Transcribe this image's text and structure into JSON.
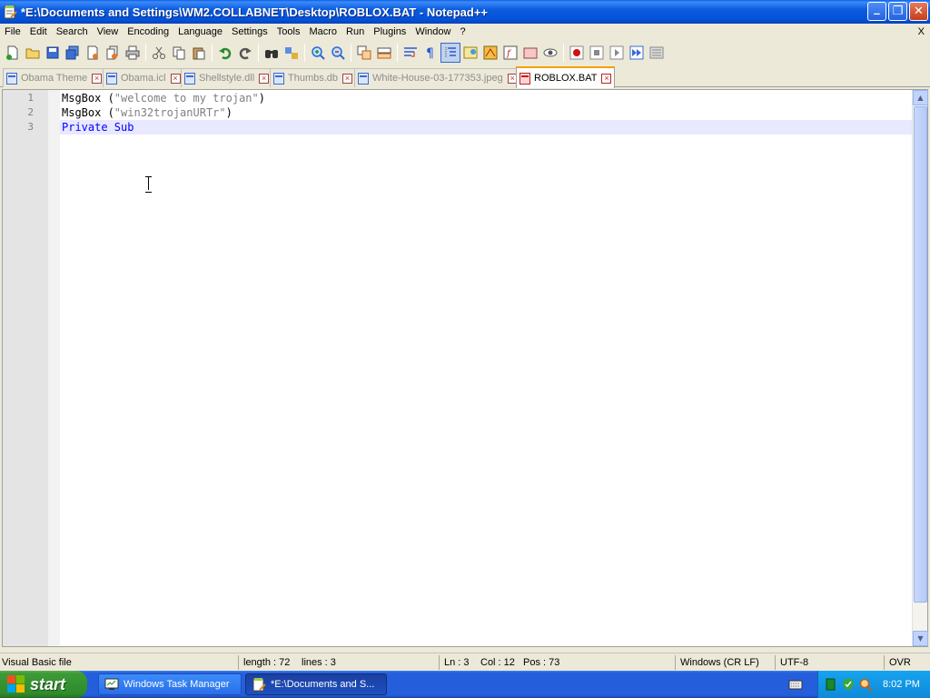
{
  "window": {
    "title": "*E:\\Documents and Settings\\WM2.COLLABNET\\Desktop\\ROBLOX.BAT - Notepad++",
    "minimize": "_",
    "restore": "❐",
    "close": "✕"
  },
  "menu": {
    "items": [
      "File",
      "Edit",
      "Search",
      "View",
      "Encoding",
      "Language",
      "Settings",
      "Tools",
      "Macro",
      "Run",
      "Plugins",
      "Window",
      "?"
    ],
    "close_label": "X"
  },
  "toolbar": {
    "buttons": [
      "new-file",
      "open-file",
      "save",
      "save-all",
      "close",
      "close-all",
      "print",
      "cut",
      "copy",
      "paste",
      "undo",
      "redo",
      "find",
      "replace",
      "zoom-in",
      "zoom-out",
      "sync-vertical",
      "sync-horizontal",
      "word-wrap",
      "show-all-chars",
      "indent-guide",
      "user-defined-language",
      "doc-map",
      "function-list",
      "folder-as-workspace",
      "monitoring",
      "record-macro",
      "stop-record",
      "playback",
      "run-macro-multiple",
      "save-macro"
    ]
  },
  "tabs": [
    {
      "label": "Obama Theme",
      "active": false
    },
    {
      "label": "Obama.icl",
      "active": false
    },
    {
      "label": "Shellstyle.dll",
      "active": false
    },
    {
      "label": "Thumbs.db",
      "active": false
    },
    {
      "label": "White-House-03-177353.jpeg",
      "active": false
    },
    {
      "label": "ROBLOX.BAT",
      "active": true
    }
  ],
  "tab_close_glyph": "×",
  "editor": {
    "line_numbers": [
      "1",
      "2",
      "3"
    ],
    "lines": [
      {
        "kw": "MsgBox (",
        "str": "\"welcome to my trojan\"",
        "end": ")"
      },
      {
        "kw": "MsgBox (",
        "str": "\"win32trojanURTr\"",
        "end": ")"
      },
      {
        "kw": "",
        "str": "",
        "end": "",
        "blue": "Private Sub"
      }
    ]
  },
  "statusbar": {
    "filetype": "Visual Basic file",
    "length": "length : 72",
    "lines": "lines : 3",
    "ln": "Ln : 3",
    "col": "Col : 12",
    "pos": "Pos : 73",
    "eol": "Windows (CR LF)",
    "encoding": "UTF-8",
    "mode": "OVR"
  },
  "taskbar": {
    "start_label": "start",
    "tasks": [
      {
        "label": "Windows Task Manager",
        "active": false
      },
      {
        "label": "*E:\\Documents and S...",
        "active": true
      }
    ],
    "clock": "8:02 PM"
  }
}
